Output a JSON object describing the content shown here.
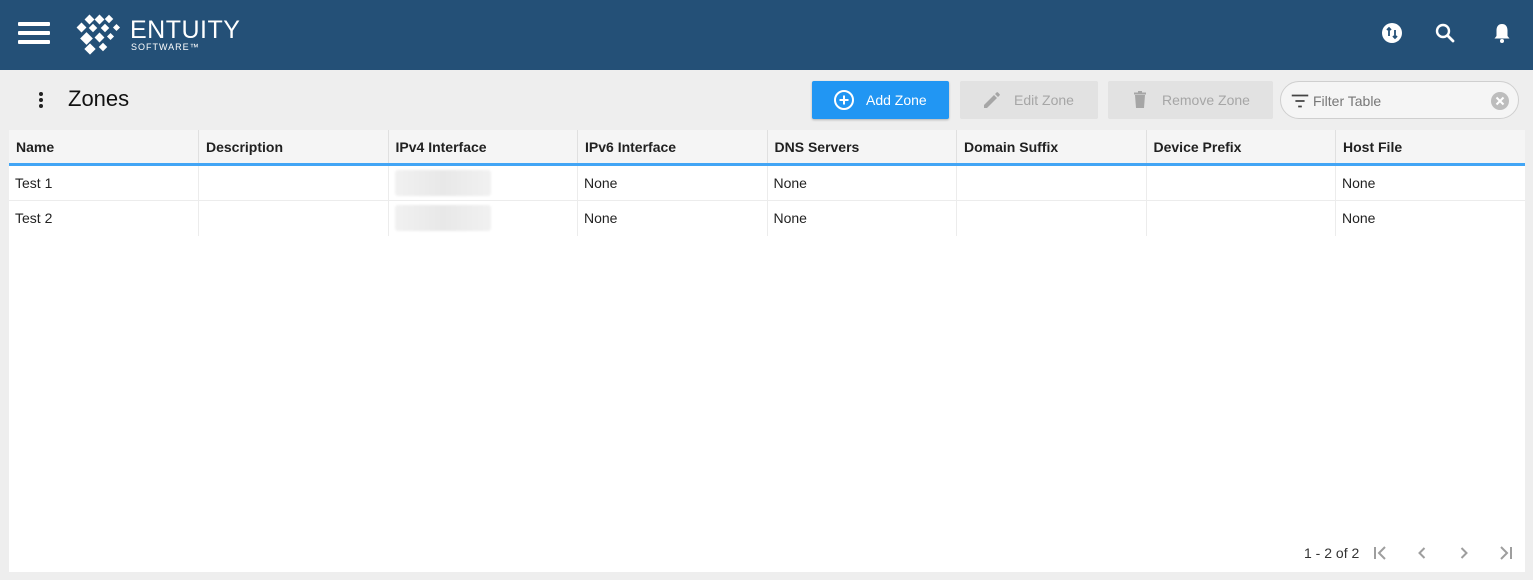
{
  "header": {
    "logo_name": "ENTUITY",
    "logo_sub": "SOFTWARE™",
    "icons": [
      "menu-icon",
      "sync-icon",
      "search-icon",
      "notifications-icon"
    ]
  },
  "page": {
    "title": "Zones"
  },
  "toolbar": {
    "add_label": "Add Zone",
    "edit_label": "Edit Zone",
    "remove_label": "Remove Zone",
    "filter_placeholder": "Filter Table",
    "add_color": "#2196f3"
  },
  "table": {
    "columns": [
      "Name",
      "Description",
      "IPv4 Interface",
      "IPv6 Interface",
      "DNS Servers",
      "Domain Suffix",
      "Device Prefix",
      "Host File"
    ],
    "rows": [
      {
        "name": "Test 1",
        "description": "",
        "ipv4": "",
        "ipv6": "None",
        "dns": "None",
        "domain_suffix": "",
        "device_prefix": "",
        "host_file": "None"
      },
      {
        "name": "Test 2",
        "description": "",
        "ipv4": "",
        "ipv6": "None",
        "dns": "None",
        "domain_suffix": "",
        "device_prefix": "",
        "host_file": "None"
      }
    ]
  },
  "pager": {
    "range_text": "1 - 2 of 2"
  },
  "colors": {
    "header_bg": "#245077",
    "accent": "#42a5f5"
  }
}
